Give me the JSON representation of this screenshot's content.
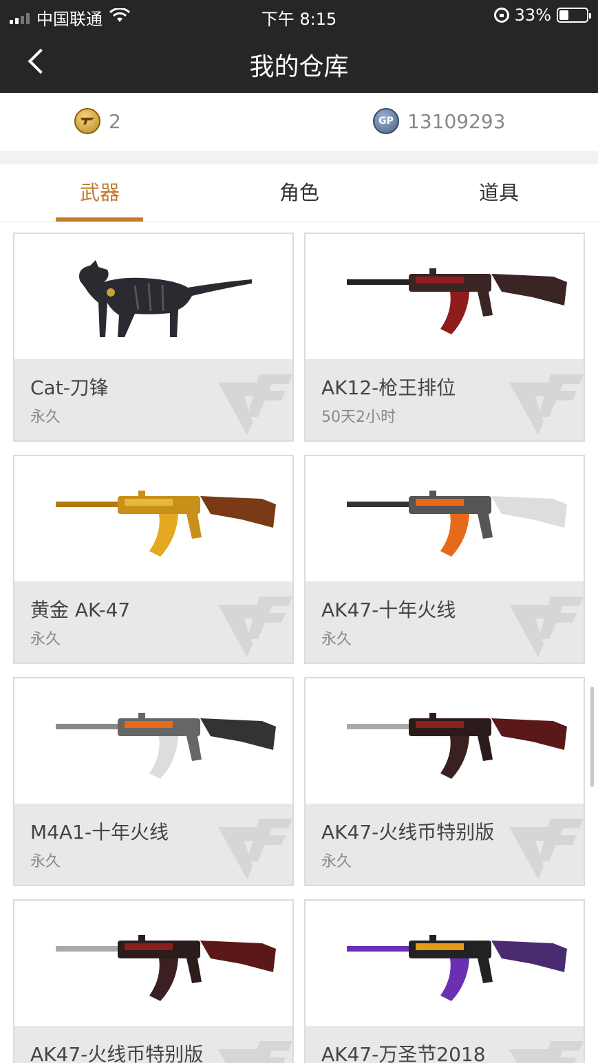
{
  "status_bar": {
    "carrier": "中国联通",
    "time": "下午 8:15",
    "battery": "33%",
    "battery_level": 0.33
  },
  "header": {
    "title": "我的仓库"
  },
  "currency": {
    "gold": {
      "icon": "gold-coin-icon",
      "value": "2"
    },
    "gp": {
      "icon": "gp-coin-icon",
      "label": "GP",
      "value": "13109293"
    }
  },
  "tabs": [
    {
      "label": "武器",
      "active": true
    },
    {
      "label": "角色",
      "active": false
    },
    {
      "label": "道具",
      "active": false
    }
  ],
  "items": [
    {
      "name": "Cat-刀锋",
      "duration": "永久",
      "image": "cat-image"
    },
    {
      "name": "AK12-枪王排位",
      "duration": "50天2小时",
      "image": "ak12-rifle-image"
    },
    {
      "name": "黄金 AK-47",
      "duration": "永久",
      "image": "gold-ak47-image"
    },
    {
      "name": "AK47-十年火线",
      "duration": "永久",
      "image": "ak47-orange-image"
    },
    {
      "name": "M4A1-十年火线",
      "duration": "永久",
      "image": "m4a1-orange-image"
    },
    {
      "name": "AK47-火线币特别版",
      "duration": "永久",
      "image": "ak47-red-image"
    },
    {
      "name": "AK47-火线币特别版",
      "duration": "",
      "image": "ak47-red-image"
    },
    {
      "name": "AK47-万圣节2018",
      "duration": "",
      "image": "ak47-halloween-image"
    }
  ],
  "colors": {
    "accent": "#c47a2c",
    "header_bg": "#262626"
  }
}
